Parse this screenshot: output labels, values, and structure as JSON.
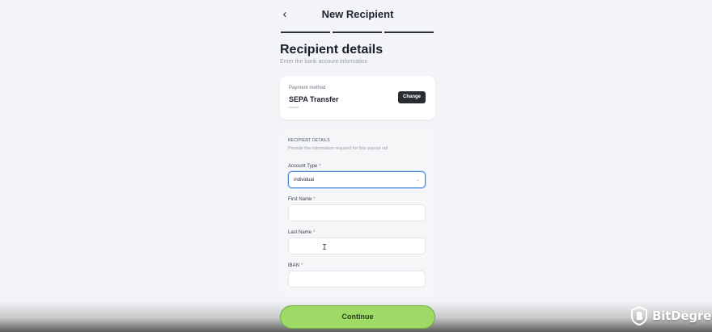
{
  "header": {
    "back_icon": "chevron-left-icon",
    "title": "New Recipient",
    "steps_total": 3
  },
  "section": {
    "title": "Recipient details",
    "subtitle": "Enter the bank account information"
  },
  "payment_method": {
    "label": "Payment method",
    "value": "SEPA Transfer",
    "note": "Instant",
    "change_label": "Change"
  },
  "form": {
    "heading": "RECIPIENT DETAILS",
    "subheading": "Provide the information required for this payout rail",
    "fields": [
      {
        "label": "Account Type",
        "required": "*",
        "value": "individual"
      },
      {
        "label": "First Name",
        "required": "*",
        "value": ""
      },
      {
        "label": "Last Name",
        "required": "*",
        "value": ""
      },
      {
        "label": "IBAN",
        "required": "*",
        "value": ""
      }
    ]
  },
  "continue_label": "Continue",
  "watermark": {
    "brand": "BitDegree"
  },
  "colors": {
    "accent": "#9ddb66",
    "focus": "#3d84d6",
    "dark_button": "#2a2c33",
    "required": "#e05a5a"
  }
}
